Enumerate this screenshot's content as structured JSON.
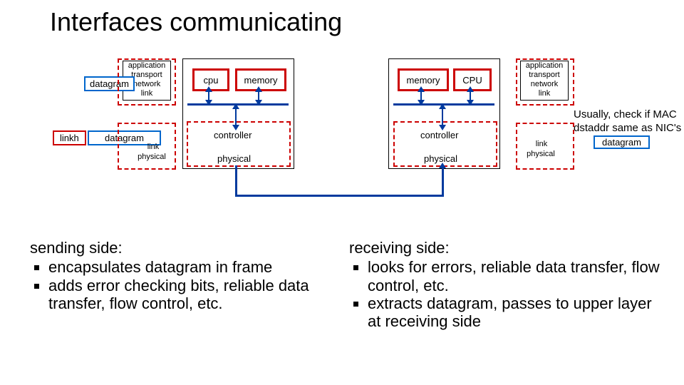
{
  "title": "Interfaces communicating",
  "left_stack": {
    "lines": [
      "application",
      "transport",
      "network",
      "link"
    ],
    "datagram_overlay": "datagram",
    "lower": {
      "linkh": "linkh",
      "datagram": "datagram",
      "link": "link",
      "physical": "physical"
    }
  },
  "right_stack": {
    "lines": [
      "application",
      "transport",
      "network",
      "link"
    ],
    "lower": {
      "link": "link",
      "physical": "physical"
    }
  },
  "host_left": {
    "cpu": "cpu",
    "memory": "memory",
    "controller": "controller",
    "physical": "physical"
  },
  "host_right": {
    "memory": "memory",
    "cpu": "CPU",
    "controller": "controller",
    "physical": "physical"
  },
  "mac_note": {
    "l1": "Usually, check if MAC",
    "l2": "dstaddr same as NIC's",
    "datagram": "datagram"
  },
  "sending": {
    "heading": "sending side:",
    "b1": "encapsulates datagram in frame",
    "b2": "adds error checking bits, reliable data transfer, flow control, etc."
  },
  "receiving": {
    "heading": "receiving side:",
    "b1": "looks for errors, reliable data transfer, flow control, etc.",
    "b2": "extracts datagram, passes to upper layer at receiving side"
  }
}
